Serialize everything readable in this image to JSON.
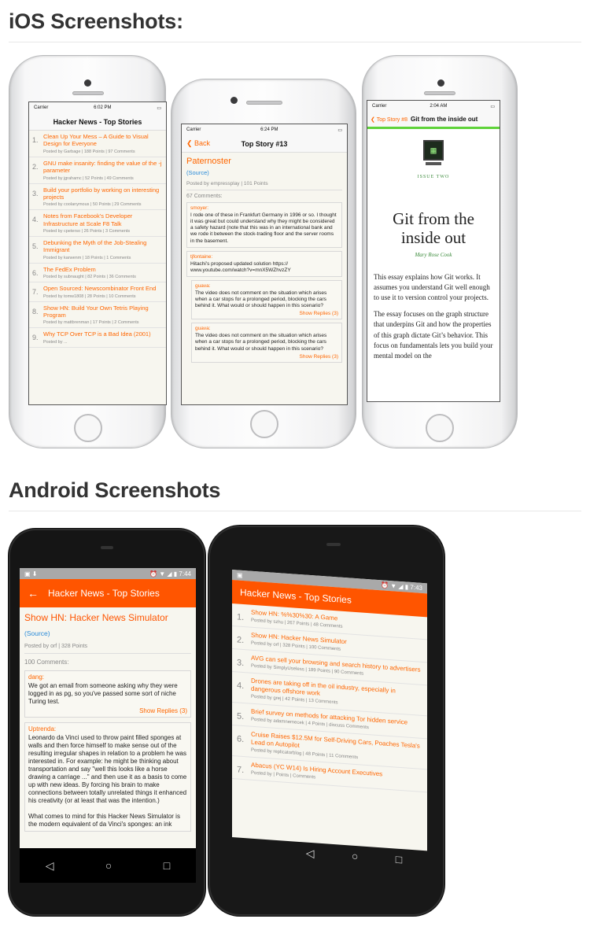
{
  "ios_heading": "iOS Screenshots:",
  "android_heading": "Android Screenshots",
  "ios1": {
    "carrier": "Carrier",
    "time": "6:02 PM",
    "title": "Hacker News - Top Stories",
    "stories": [
      {
        "n": "1.",
        "t": "Clean Up Your Mess – A Guide to Visual Design for Everyone",
        "p": "Posted by Garbage | 188 Points | 97 Comments"
      },
      {
        "n": "2.",
        "t": "GNU make insanity: finding the value of the -j parameter",
        "p": "Posted by jgrahamc | 52 Points | 49 Comments"
      },
      {
        "n": "3.",
        "t": "Build your portfolio by working on interesting projects",
        "p": "Posted by coolanymous | 50 Points | 29 Comments"
      },
      {
        "n": "4.",
        "t": "Notes from Facebook’s Developer Infrastructure at Scale F8 Talk",
        "p": "Posted by cpeterso | 26 Points | 3 Comments"
      },
      {
        "n": "5.",
        "t": "Debunking the Myth of the Job-Stealing Immigrant",
        "p": "Posted by karwenm | 18 Points | 1 Comments"
      },
      {
        "n": "6.",
        "t": "The FedEx Problem",
        "p": "Posted by subnaught | 82 Points | 36 Comments"
      },
      {
        "n": "7.",
        "t": "Open Sourced: Newscombinator Front End",
        "p": "Posted by tomw1808 | 28 Points | 10 Comments"
      },
      {
        "n": "8.",
        "t": "Show HN: Build Your Own Tetris Playing Program",
        "p": "Posted by mattbrenman | 17 Points | 2 Comments"
      },
      {
        "n": "9.",
        "t": "Why TCP Over TCP is a Bad Idea (2001)",
        "p": "Posted by ..."
      }
    ]
  },
  "ios2": {
    "carrier": "Carrier",
    "time": "6:24 PM",
    "back": "Back",
    "title": "Top Story #13",
    "story_title": "Paternoster",
    "source": "(Source)",
    "posted": "Posted by empressplay | 101 Points",
    "comments_count": "67 Comments:",
    "comments": [
      {
        "au": "smoyer:",
        "tx": "I rode one of these in Frankfurt Germany in 1996 or so. I thought it was great but could understand why they might be considered a safety hazard (note that this was in an international bank and we rode it between the stock-trading floor and the server rooms in the basement.",
        "sr": ""
      },
      {
        "au": "tjfontaine:",
        "tx": "Hitachi's proposed updated solution https:// www.youtube.com/watch?v=mnX5WZhvzZY",
        "sr": ""
      },
      {
        "au": "guava:",
        "tx": "The video does not comment on the situation which arises when a car stops for a prolonged period, blocking the cars behind it. What would or should happen in this scenario?",
        "sr": "Show Replies (3)"
      },
      {
        "au": "guava:",
        "tx": "The video does not comment on the situation which arises when a car stops for a prolonged period, blocking the cars behind it. What would or should happen in this scenario?",
        "sr": "Show Replies (3)"
      }
    ]
  },
  "ios3": {
    "carrier": "Carrier",
    "time": "2:04 AM",
    "back": "Top Story #8",
    "title": "Git from the inside out",
    "issue": "ISSUE TWO",
    "heading": "Git from the inside out",
    "author": "Mary Rose Cook",
    "p1": "This essay explains how Git works. It assumes you understand Git well enough to use it to version control your projects.",
    "p2": "The essay focuses on the graph structure that underpins Git and how the properties of this graph dictate Git’s behavior. This focus on fundamentals lets you build your mental model on the"
  },
  "and1": {
    "time": "7:44",
    "title": "Hacker News - Top Stories",
    "story_title": "Show HN: Hacker News Simulator",
    "source": "(Source)",
    "posted": "Posted by orf | 328 Points",
    "comments_count": "100 Comments:",
    "comments": [
      {
        "au": "dang:",
        "tx": "We got an email from someone asking why they were logged in as pg, so you've passed some sort of niche Turing test.",
        "sr": "Show Replies (3)"
      },
      {
        "au": "Uptrenda:",
        "tx": "Leonardo da Vinci used to throw paint filled sponges at walls and then force himself to make sense out of the resulting irregular shapes in relation to a problem he was interested in. For example: he might be thinking about transportation and say \"well this looks like a horse drawing a carriage ...\" and then use it as a basis to come up with new ideas. By forcing his brain to make connections between totally unrelated things it enhanced his creativity (or at least that was the intention.)\n\nWhat comes to mind for this Hacker News Simulator is the modern equivalent of da Vinci's sponges: an ink",
        "sr": ""
      }
    ]
  },
  "and2": {
    "time": "7:43",
    "title": "Hacker News - Top Stories",
    "stories": [
      {
        "n": "1.",
        "t": "Show HN: %%30%30: A Game",
        "p": "Posted by szhu | 267 Points | 48 Comments"
      },
      {
        "n": "2.",
        "t": "Show HN: Hacker News Simulator",
        "p": "Posted by orf | 328 Points | 100 Comments"
      },
      {
        "n": "3.",
        "t": "AVG can sell your browsing and search history to advertisers",
        "p": "Posted by SimplyUseless | 189 Points | 90 Comments"
      },
      {
        "n": "4.",
        "t": "Drones are taking off in the oil industry, especially in dangerous offshore work",
        "p": "Posted by grej | 42 Points | 13 Comments"
      },
      {
        "n": "5.",
        "t": "Brief survey on methods for attacking Tor hidden service",
        "p": "Posted by adamnemecek | 4 Points | discuss Comments"
      },
      {
        "n": "6.",
        "t": "Cruise Raises $12.5M for Self-Driving Cars, Poaches Tesla's Lead on Autopilot",
        "p": "Posted by replicatorblog | 48 Points | 11 Comments"
      },
      {
        "n": "7.",
        "t": "Abacus (YC W14) Is Hiring Account Executives",
        "p": "Posted by | Points | Comments"
      }
    ]
  }
}
